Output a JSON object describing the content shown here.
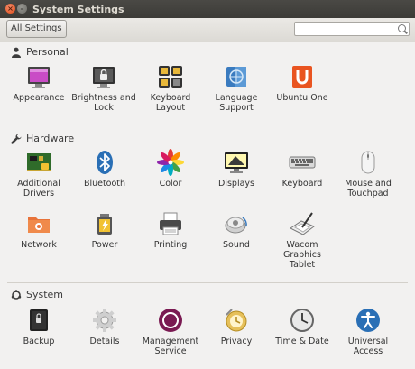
{
  "window": {
    "title": "System Settings",
    "close_glyph": "×",
    "minimize_glyph": "–"
  },
  "toolbar": {
    "all_settings_label": "All Settings",
    "search_value": "",
    "search_placeholder": ""
  },
  "sections": {
    "personal": {
      "label": "Personal",
      "icon": "person-icon",
      "items": [
        {
          "label": "Appearance",
          "icon": "appearance-icon"
        },
        {
          "label": "Brightness and Lock",
          "icon": "brightness-lock-icon"
        },
        {
          "label": "Keyboard Layout",
          "icon": "keyboard-layout-icon"
        },
        {
          "label": "Language Support",
          "icon": "language-icon"
        },
        {
          "label": "Ubuntu One",
          "icon": "ubuntu-one-icon"
        }
      ]
    },
    "hardware": {
      "label": "Hardware",
      "icon": "wrench-icon",
      "items": [
        {
          "label": "Additional Drivers",
          "icon": "drivers-icon"
        },
        {
          "label": "Bluetooth",
          "icon": "bluetooth-icon"
        },
        {
          "label": "Color",
          "icon": "color-icon"
        },
        {
          "label": "Displays",
          "icon": "displays-icon"
        },
        {
          "label": "Keyboard",
          "icon": "keyboard-icon"
        },
        {
          "label": "Mouse and Touchpad",
          "icon": "mouse-icon"
        },
        {
          "label": "Network",
          "icon": "network-icon"
        },
        {
          "label": "Power",
          "icon": "power-icon"
        },
        {
          "label": "Printing",
          "icon": "printer-icon"
        },
        {
          "label": "Sound",
          "icon": "sound-icon"
        },
        {
          "label": "Wacom Graphics Tablet",
          "icon": "wacom-tablet-icon"
        }
      ]
    },
    "system": {
      "label": "System",
      "icon": "ubuntu-logo-icon",
      "items": [
        {
          "label": "Backup",
          "icon": "backup-icon"
        },
        {
          "label": "Details",
          "icon": "details-gear-icon"
        },
        {
          "label": "Management Service",
          "icon": "management-service-icon"
        },
        {
          "label": "Privacy",
          "icon": "privacy-icon"
        },
        {
          "label": "Time & Date",
          "icon": "clock-icon"
        },
        {
          "label": "Universal Access",
          "icon": "universal-access-icon"
        }
      ]
    }
  },
  "colors": {
    "titlebar": "#3c3b37",
    "close_button": "#df4a16",
    "background": "#f2f1f0",
    "ubuntu_one": "#e95420",
    "management": "#7a1a52"
  }
}
